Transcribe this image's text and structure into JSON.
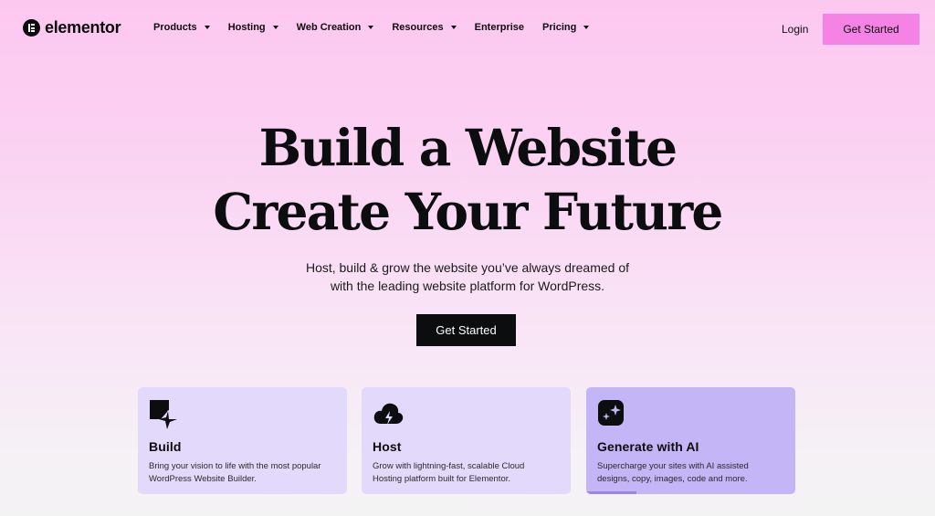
{
  "brand": {
    "name": "elementor"
  },
  "nav": {
    "items": [
      {
        "label": "Products",
        "has_dropdown": true
      },
      {
        "label": "Hosting",
        "has_dropdown": true
      },
      {
        "label": "Web Creation",
        "has_dropdown": true
      },
      {
        "label": "Resources",
        "has_dropdown": true
      },
      {
        "label": "Enterprise",
        "has_dropdown": false
      },
      {
        "label": "Pricing",
        "has_dropdown": true
      }
    ],
    "login_label": "Login",
    "cta_label": "Get Started"
  },
  "hero": {
    "title_line1": "Build a Website",
    "title_line2": "Create Your Future",
    "subtitle_line1": "Host, build & grow the website you’ve always dreamed of",
    "subtitle_line2": "with the leading website platform for WordPress.",
    "cta_label": "Get Started"
  },
  "cards": [
    {
      "icon": "cursor-square-icon",
      "title": "Build",
      "desc_line1": "Bring your vision to life with the most popular",
      "desc_line2": "WordPress Website Builder."
    },
    {
      "icon": "cloud-bolt-icon",
      "title": "Host",
      "desc_line1": "Grow with lightning-fast, scalable Cloud",
      "desc_line2": "Hosting platform built for Elementor."
    },
    {
      "icon": "ai-sparkle-icon",
      "title": "Generate with AI",
      "desc_line1": "Supercharge your sites with AI assisted",
      "desc_line2": "designs, copy, images, code and more.",
      "active": true,
      "progress": 0.24
    }
  ],
  "colors": {
    "accent_pink": "#f582e5",
    "card_lavender": "#e3d9fb",
    "card_active": "#c3b5f6",
    "text_dark": "#0c0d0e"
  }
}
